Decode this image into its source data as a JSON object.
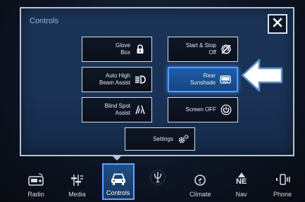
{
  "panel": {
    "title": "Controls"
  },
  "buttons": {
    "glove_box": {
      "line1": "Glove",
      "line2": "Box",
      "icon": "lock-icon"
    },
    "start_stop": {
      "line1": "Start & Stop",
      "line2": "Off",
      "icon": "start-stop-off-icon"
    },
    "auto_high_beam": {
      "line1": "Auto High",
      "line2": "Beam Assist",
      "icon": "high-beam-icon"
    },
    "rear_sunshade": {
      "line1": "Rear",
      "line2": "Sunshade",
      "icon": "sunshade-icon",
      "active": true
    },
    "blind_spot": {
      "line1": "Blind Spot",
      "line2": "Assist",
      "icon": "blind-spot-icon"
    },
    "screen_off": {
      "line1": "Screen OFF",
      "icon": "power-icon"
    },
    "settings": {
      "label": "Settings",
      "icon": "gears-icon"
    }
  },
  "nav": [
    {
      "label": "Radio",
      "icon": "radio-icon"
    },
    {
      "label": "Media",
      "icon": "media-icon"
    },
    {
      "label": "Controls",
      "icon": "car-icon",
      "active": true
    },
    {
      "label": "",
      "icon": "trident-logo-icon"
    },
    {
      "label": "Climate",
      "icon": "climate-icon"
    },
    {
      "label": "Nav",
      "icon": "compass-ne-icon",
      "heading": "NE"
    },
    {
      "label": "Phone",
      "icon": "phone-icon"
    }
  ],
  "colors": {
    "accent": "#4f9cff",
    "panel_bg": "#1a3256",
    "button_bg": "#0f1726"
  }
}
